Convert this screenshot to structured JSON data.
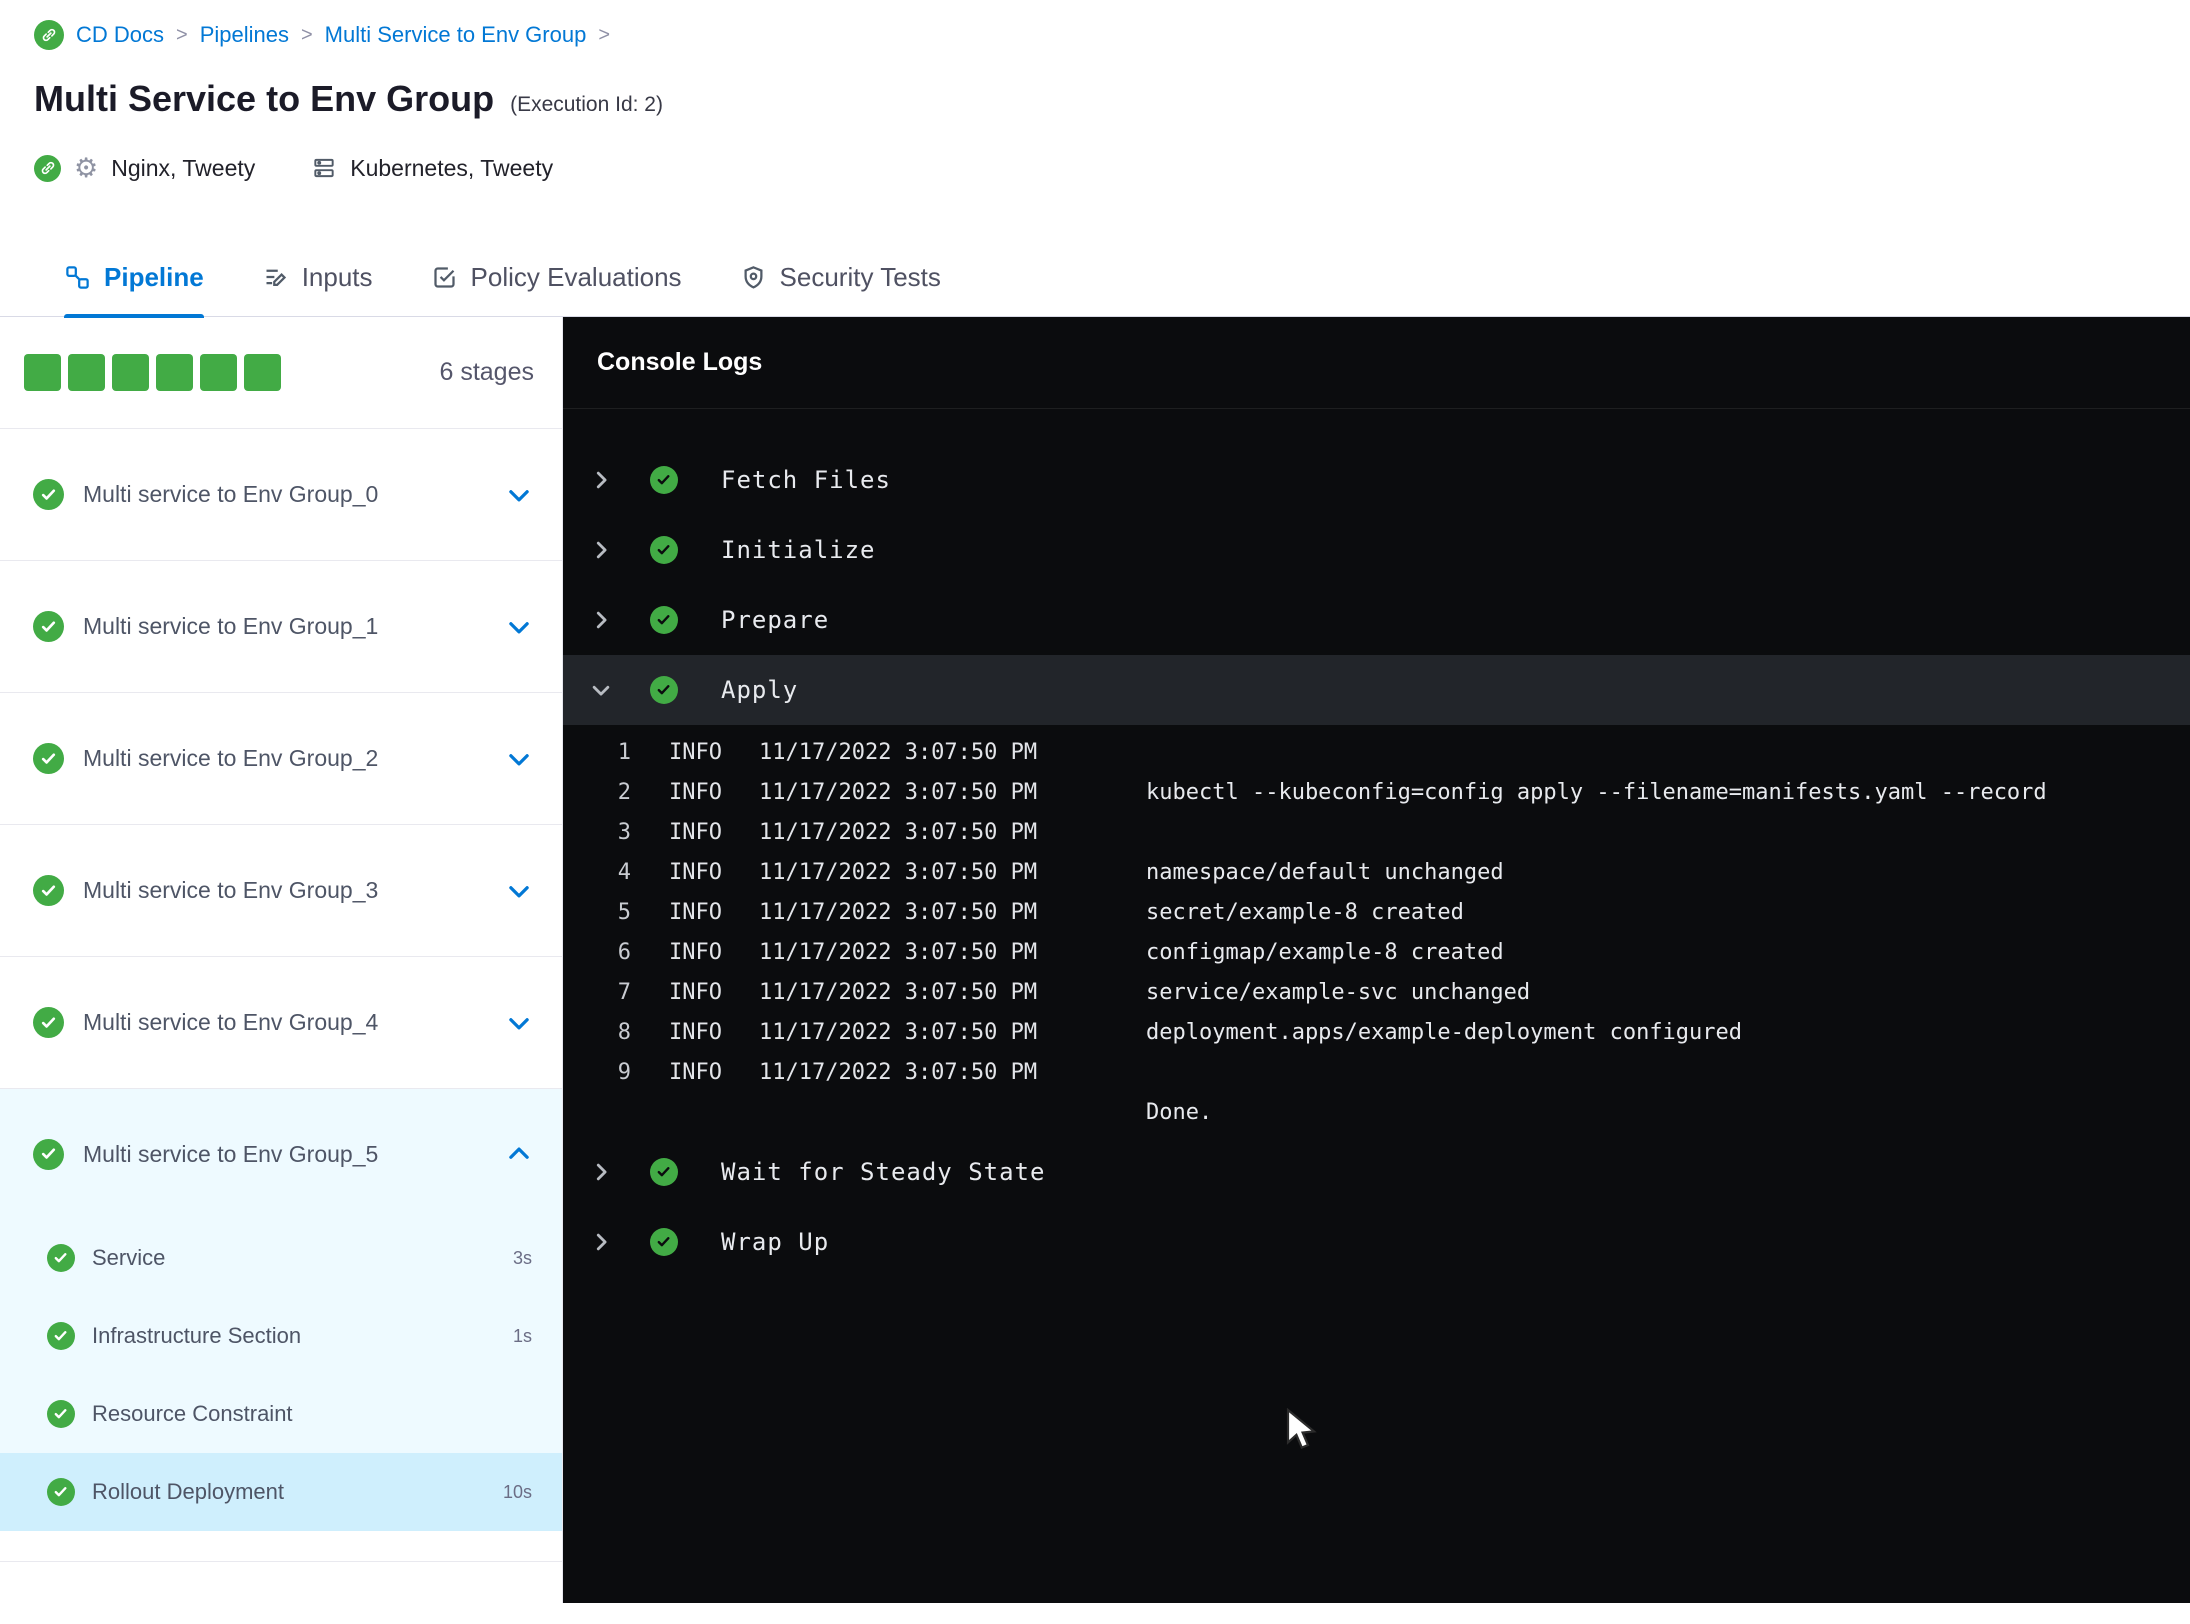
{
  "colors": {
    "accent_blue": "#0278d5",
    "success_green": "#42ab45",
    "console_bg": "#0b0c0e",
    "expanded_stage_bg": "#eefaff",
    "selected_step_bg": "#cfeffd",
    "expanded_console_row_bg": "#22252a"
  },
  "breadcrumb": {
    "items": [
      "CD Docs",
      "Pipelines",
      "Multi Service to Env Group"
    ]
  },
  "header": {
    "title": "Multi Service to Env Group",
    "execution_id": "(Execution Id: 2)",
    "services_label": "Nginx, Tweety",
    "environment_label": "Kubernetes, Tweety"
  },
  "tabs": {
    "pipeline": "Pipeline",
    "inputs": "Inputs",
    "policy": "Policy Evaluations",
    "security": "Security Tests"
  },
  "sidebar": {
    "stage_count_label": "6 stages",
    "stage_square_count": 6,
    "stages": [
      {
        "label": "Multi service to Env Group_0",
        "expanded": false
      },
      {
        "label": "Multi service to Env Group_1",
        "expanded": false
      },
      {
        "label": "Multi service to Env Group_2",
        "expanded": false
      },
      {
        "label": "Multi service to Env Group_3",
        "expanded": false
      },
      {
        "label": "Multi service to Env Group_4",
        "expanded": false
      },
      {
        "label": "Multi service to Env Group_5",
        "expanded": true,
        "steps": [
          {
            "label": "Service",
            "duration": "3s",
            "selected": false
          },
          {
            "label": "Infrastructure Section",
            "duration": "1s",
            "selected": false
          },
          {
            "label": "Resource Constraint",
            "duration": "",
            "selected": false
          },
          {
            "label": "Rollout Deployment",
            "duration": "10s",
            "selected": true
          }
        ]
      }
    ]
  },
  "console": {
    "title": "Console Logs",
    "steps": [
      {
        "label": "Fetch Files",
        "expanded": false
      },
      {
        "label": "Initialize",
        "expanded": false
      },
      {
        "label": "Prepare",
        "expanded": false
      },
      {
        "label": "Apply",
        "expanded": true,
        "logs": [
          {
            "n": "1",
            "level": "INFO",
            "time": "11/17/2022 3:07:50 PM",
            "msg": ""
          },
          {
            "n": "2",
            "level": "INFO",
            "time": "11/17/2022 3:07:50 PM",
            "msg": "kubectl --kubeconfig=config apply --filename=manifests.yaml --record"
          },
          {
            "n": "3",
            "level": "INFO",
            "time": "11/17/2022 3:07:50 PM",
            "msg": ""
          },
          {
            "n": "4",
            "level": "INFO",
            "time": "11/17/2022 3:07:50 PM",
            "msg": "namespace/default unchanged"
          },
          {
            "n": "5",
            "level": "INFO",
            "time": "11/17/2022 3:07:50 PM",
            "msg": "secret/example-8 created"
          },
          {
            "n": "6",
            "level": "INFO",
            "time": "11/17/2022 3:07:50 PM",
            "msg": "configmap/example-8 created"
          },
          {
            "n": "7",
            "level": "INFO",
            "time": "11/17/2022 3:07:50 PM",
            "msg": "service/example-svc unchanged"
          },
          {
            "n": "8",
            "level": "INFO",
            "time": "11/17/2022 3:07:50 PM",
            "msg": "deployment.apps/example-deployment configured"
          },
          {
            "n": "9",
            "level": "INFO",
            "time": "11/17/2022 3:07:50 PM",
            "msg": ""
          },
          {
            "n": "",
            "level": "",
            "time": "",
            "msg": "Done."
          }
        ]
      },
      {
        "label": "Wait for Steady State",
        "expanded": false
      },
      {
        "label": "Wrap Up",
        "expanded": false
      }
    ]
  }
}
